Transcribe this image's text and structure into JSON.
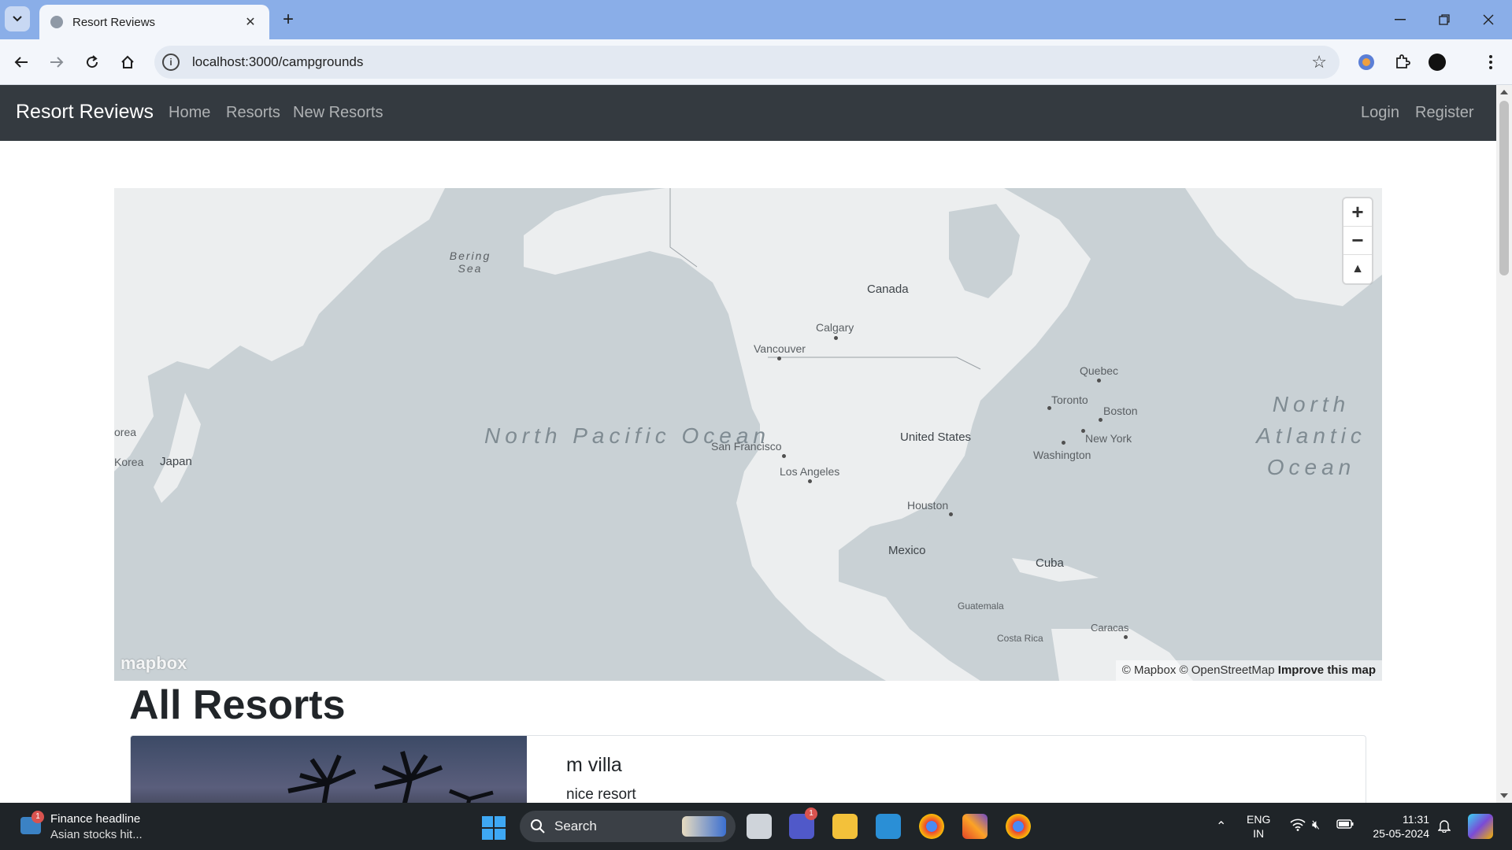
{
  "browser": {
    "tab_title": "Resort Reviews",
    "url": "localhost:3000/campgrounds"
  },
  "navbar": {
    "brand": "Resort Reviews",
    "links": [
      "Home",
      "Resorts",
      "New Resorts"
    ],
    "right_links": [
      "Login",
      "Register"
    ]
  },
  "map": {
    "oceans": [
      "North Pacific Ocean",
      "North Atlantic Ocean"
    ],
    "sea": "Bering Sea",
    "countries": [
      "Canada",
      "United States",
      "Mexico",
      "Japan",
      "Cuba"
    ],
    "partial_labels": [
      "orea",
      "Korea"
    ],
    "cities": [
      "Calgary",
      "Vancouver",
      "Quebec",
      "Toronto",
      "Boston",
      "New York",
      "Washington",
      "San Francisco",
      "Los Angeles",
      "Houston",
      "Guatemala",
      "Costa Rica",
      "Caracas"
    ],
    "attribution": "© Mapbox © OpenStreetMap",
    "improve": "Improve this map",
    "logo": "mapbox",
    "zoom_in": "+",
    "zoom_out": "−",
    "compass": "▲"
  },
  "page": {
    "heading": "All Resorts",
    "cards": [
      {
        "title": "m villa",
        "description": "nice resort"
      }
    ]
  },
  "taskbar": {
    "news_title": "Finance headline",
    "news_subtitle": "Asian stocks hit...",
    "news_badge": "1",
    "search_placeholder": "Search",
    "teams_badge": "1",
    "lang_line1": "ENG",
    "lang_line2": "IN",
    "time": "11:31",
    "date": "25-05-2024"
  },
  "colors": {
    "navbar_bg": "#343a40",
    "map_water": "#c9d1d5",
    "map_land": "#eeeeee",
    "tabbar_bg": "#8aaee8"
  }
}
